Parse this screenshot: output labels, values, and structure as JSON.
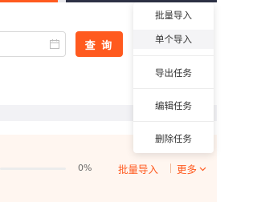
{
  "toolbar": {
    "query_label": "查 询"
  },
  "task": {
    "progress_text": "0%",
    "progress_value": 0,
    "batch_import_label": "批量导入",
    "more_label": "更多"
  },
  "dropdown": {
    "items": [
      {
        "label": "批量导入",
        "hovered": false
      },
      {
        "label": "单个导入",
        "hovered": true
      },
      {
        "label": "导出任务",
        "hovered": false
      },
      {
        "label": "编辑任务",
        "hovered": false
      },
      {
        "label": "删除任务",
        "hovered": false
      }
    ]
  },
  "colors": {
    "accent": "#ff5a1f",
    "row_background": "#fff6f0"
  },
  "icons": {
    "date": "calendar-icon",
    "more": "chevron-down-icon"
  }
}
